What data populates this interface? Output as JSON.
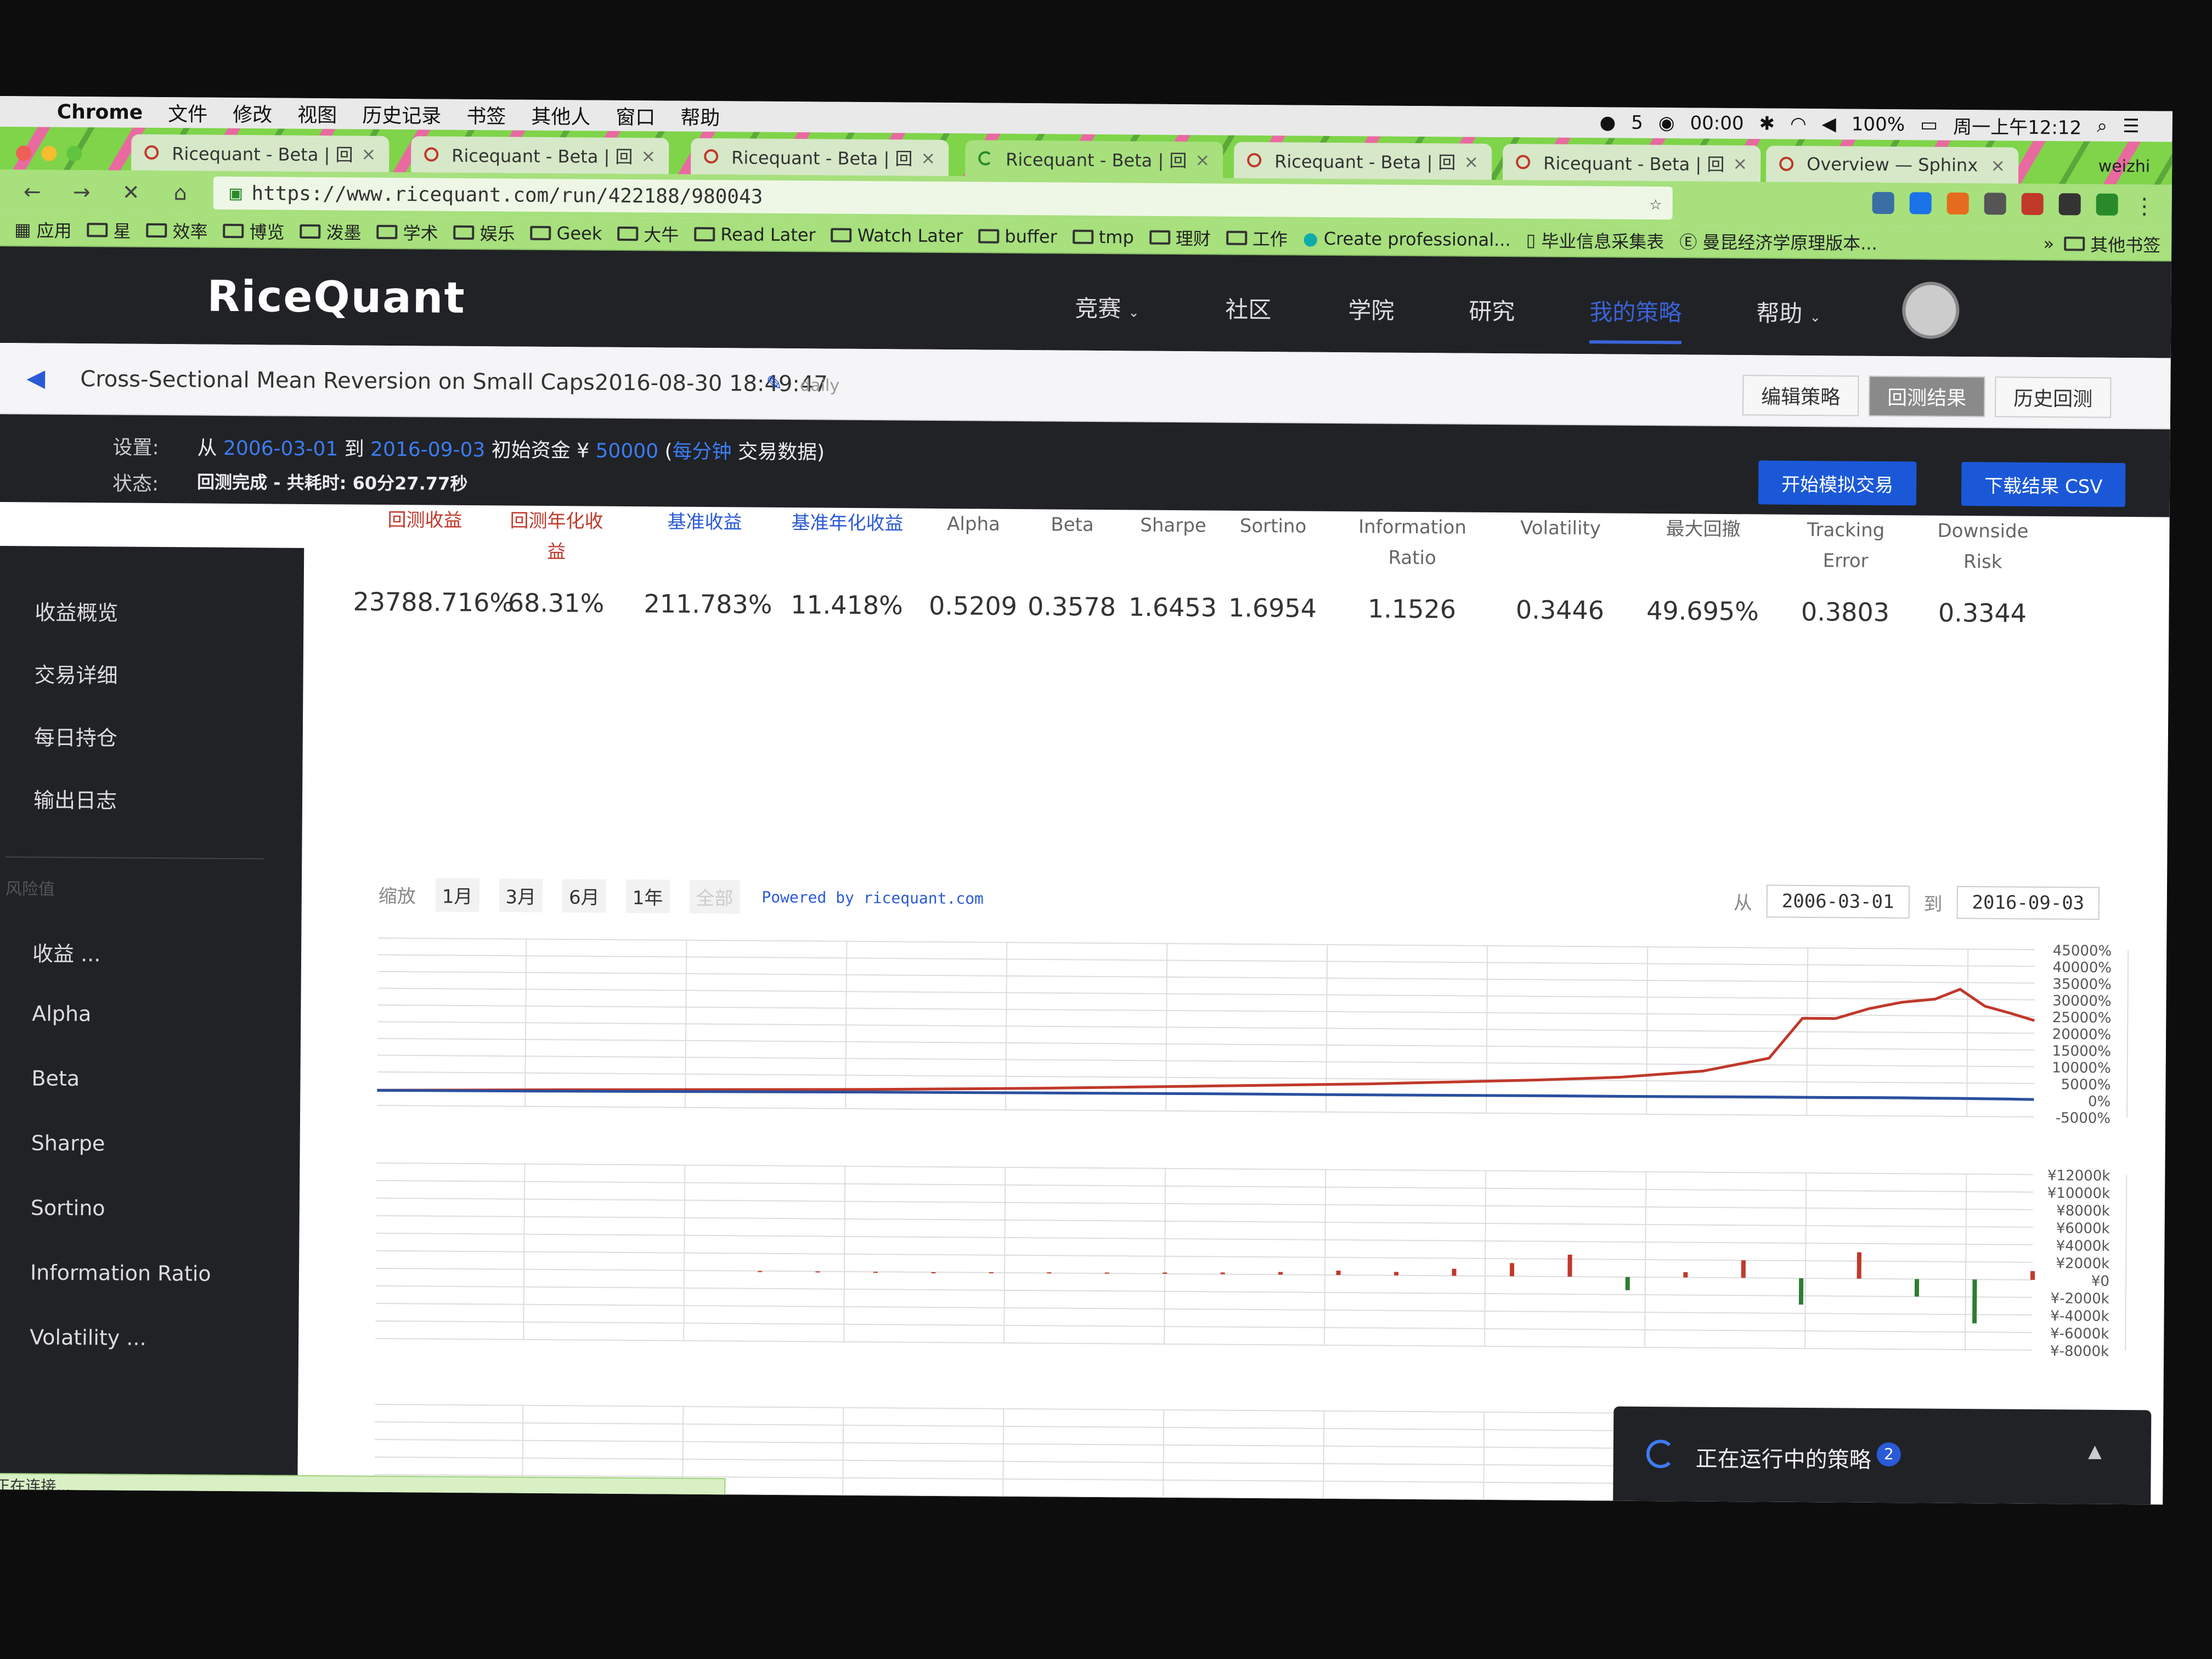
{
  "menubar": {
    "app": "Chrome",
    "items": [
      "文件",
      "修改",
      "视图",
      "历史记录",
      "书签",
      "其他人",
      "窗口",
      "帮助"
    ],
    "status": [
      "5",
      "00:00",
      "100%",
      "周一上午12:12"
    ]
  },
  "tabs": [
    {
      "label": "Ricequant - Beta | 回"
    },
    {
      "label": "Ricequant - Beta | 回"
    },
    {
      "label": "Ricequant - Beta | 回"
    },
    {
      "label": "Ricequant - Beta | 回"
    },
    {
      "label": "Ricequant - Beta | 回"
    },
    {
      "label": "Ricequant - Beta | 回"
    },
    {
      "label": "Overview — Sphinx"
    }
  ],
  "profile": "weizhi",
  "url": "https://www.ricequant.com/run/422188/980043",
  "bookmarks": [
    "应用",
    "星",
    "效率",
    "博览",
    "泼墨",
    "学术",
    "娱乐",
    "Geek",
    "大牛",
    "Read Later",
    "Watch Later",
    "buffer",
    "tmp",
    "理财",
    "工作",
    "Create professional...",
    "毕业信息采集表",
    "曼昆经济学原理版本...",
    "其他书签"
  ],
  "rq": {
    "logo": "RiceQuant",
    "nav": [
      "竞赛",
      "社区",
      "学院",
      "研究",
      "我的策略",
      "帮助"
    ]
  },
  "strategy": {
    "title": "Cross-Sectional Mean Reversion on Small Caps2016-08-30 18:49:47",
    "frequency": "daily",
    "buttons": [
      "编辑策略",
      "回测结果",
      "历史回测"
    ]
  },
  "settings": {
    "label": "设置:",
    "from": "从",
    "start": "2006-03-01",
    "to": "到",
    "end": "2016-09-03",
    "capital_label": "初始资金 ¥",
    "capital": "50000",
    "paren_open": "(",
    "freq": "每分钟",
    "data_label": "交易数据)",
    "status_label": "状态:",
    "status": "回测完成 - 共耗时: 60分27.77秒",
    "btn_sim": "开始模拟交易",
    "btn_csv": "下载结果 CSV"
  },
  "sidebar": {
    "items": [
      "收益概览",
      "交易详细",
      "每日持仓",
      "输出日志"
    ],
    "section": "风险值",
    "risk": [
      "收益 ...",
      "Alpha",
      "Beta",
      "Sharpe",
      "Sortino",
      "Information Ratio",
      "Volatility ..."
    ]
  },
  "metrics": [
    {
      "label": "回测收益",
      "value": "23788.716%"
    },
    {
      "label": "回测年化收益",
      "value": "68.31%"
    },
    {
      "label": "基准收益",
      "value": "211.783%"
    },
    {
      "label": "基准年化收益",
      "value": "11.418%"
    },
    {
      "label": "Alpha",
      "value": "0.5209"
    },
    {
      "label": "Beta",
      "value": "0.3578"
    },
    {
      "label": "Sharpe",
      "value": "1.6453"
    },
    {
      "label": "Sortino",
      "value": "1.6954"
    },
    {
      "label": "Information Ratio",
      "value": "1.1526"
    },
    {
      "label": "Volatility",
      "value": "0.3446"
    },
    {
      "label": "最大回撤",
      "value": "49.695%"
    },
    {
      "label": "Tracking Error",
      "value": "0.3803"
    },
    {
      "label": "Downside Risk",
      "value": "0.3344"
    }
  ],
  "zoom": {
    "label": "缩放",
    "options": [
      "1月",
      "3月",
      "6月",
      "1年",
      "全部"
    ],
    "powered": "Powered by ricequant.com",
    "from": "从",
    "start": "2006-03-01",
    "to": "到",
    "end": "2016-09-03"
  },
  "colors": {
    "strategy": "#c0392b",
    "benchmark": "#2a4f9e",
    "accent": "#1a58d8"
  },
  "chart_data": [
    {
      "type": "line",
      "ylabel": "",
      "ylim": [
        -5000,
        45000
      ],
      "yticks": [
        "45000%",
        "40000%",
        "35000%",
        "30000%",
        "25000%",
        "20000%",
        "15000%",
        "10000%",
        "5000%",
        "0%",
        "-5000%"
      ],
      "x": [
        0,
        0.1,
        0.2,
        0.3,
        0.4,
        0.5,
        0.6,
        0.7,
        0.75,
        0.8,
        0.84,
        0.86,
        0.88,
        0.9,
        0.92,
        0.94,
        0.955,
        0.97,
        0.985,
        1.0
      ],
      "series": [
        {
          "values": [
            -500,
            0,
            400,
            800,
            1500,
            2500,
            3500,
            5000,
            6000,
            8000,
            12000,
            24000,
            24000,
            27000,
            29000,
            30000,
            33000,
            28000,
            26000,
            23800
          ]
        },
        {
          "values": [
            -500,
            -400,
            -200,
            0,
            100,
            200,
            200,
            300,
            300,
            350,
            400,
            400,
            400,
            450,
            450,
            400,
            400,
            350,
            300,
            212
          ]
        }
      ]
    },
    {
      "type": "bar",
      "ylim": [
        -8000,
        12000
      ],
      "yticks": [
        "¥12000k",
        "¥10000k",
        "¥8000k",
        "¥6000k",
        "¥4000k",
        "¥2000k",
        "¥0",
        "¥-2000k",
        "¥-4000k",
        "¥-6000k",
        "¥-8000k"
      ],
      "values": [
        0,
        0,
        0,
        0,
        50,
        80,
        100,
        150,
        200,
        300,
        500,
        400,
        800,
        1500,
        2500,
        -1500,
        600,
        2000,
        -3000,
        3000,
        -2000,
        -5000,
        1000
      ]
    }
  ],
  "running": {
    "label": "正在运行中的策略",
    "count": "2"
  },
  "statusbar": "正在连接..."
}
